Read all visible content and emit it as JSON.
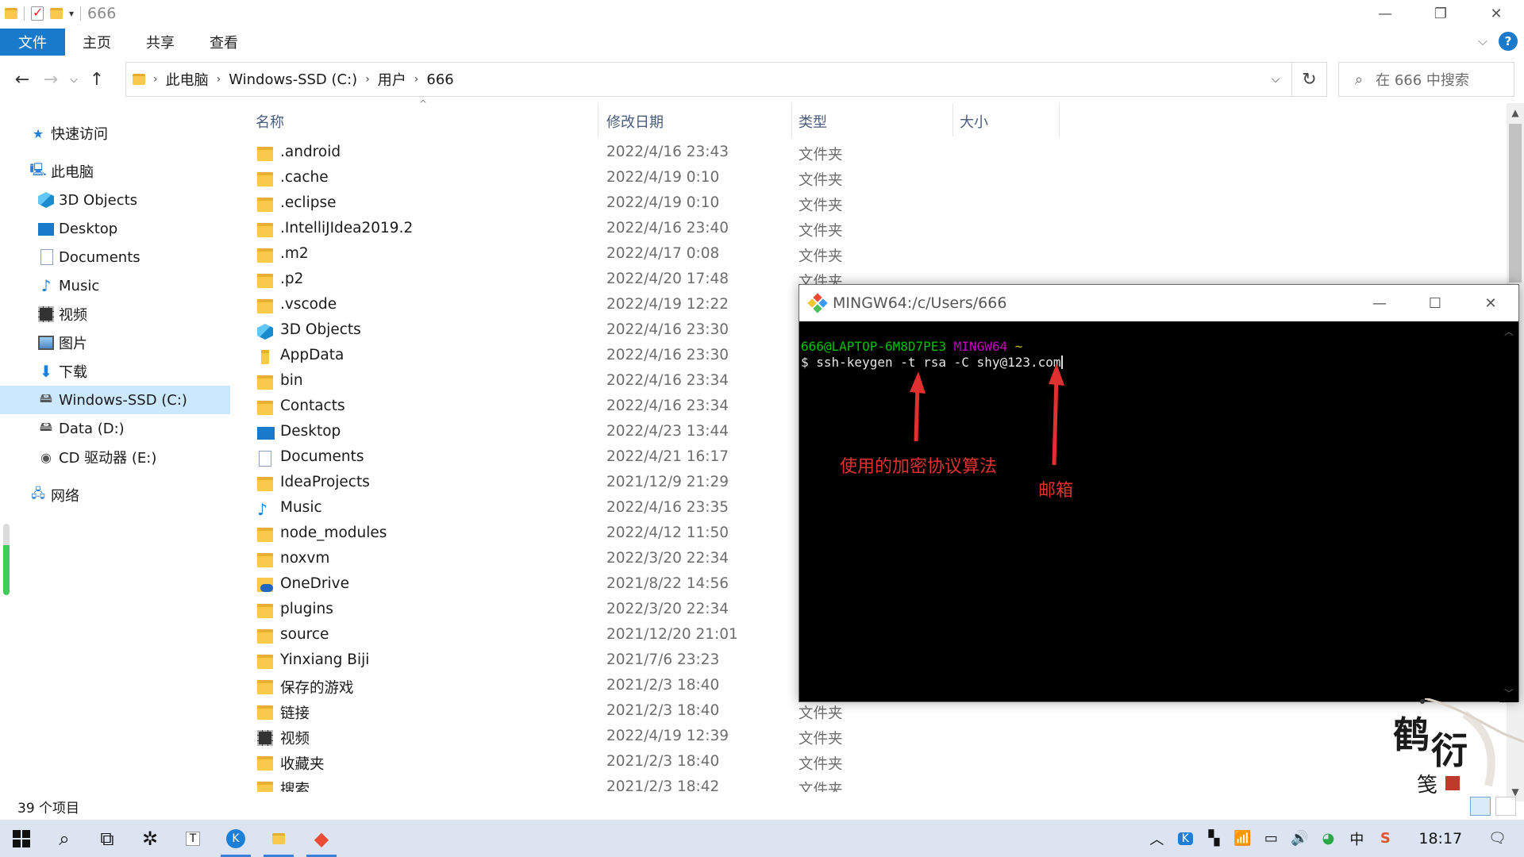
{
  "explorer": {
    "title": "666",
    "ribbon_tabs": [
      "文件",
      "主页",
      "共享",
      "查看"
    ],
    "breadcrumb": [
      "此电脑",
      "Windows-SSD (C:)",
      "用户",
      "666"
    ],
    "search_placeholder": "在 666 中搜索",
    "columns": [
      "名称",
      "修改日期",
      "类型",
      "大小"
    ],
    "sidebar": {
      "quick_access": "快速访问",
      "this_pc": "此电脑",
      "items": [
        "3D Objects",
        "Desktop",
        "Documents",
        "Music",
        "视频",
        "图片",
        "下载",
        "Windows-SSD (C:)",
        "Data (D:)",
        "CD 驱动器 (E:)"
      ],
      "network": "网络"
    },
    "files": [
      {
        "name": ".android",
        "date": "2022/4/16 23:43",
        "type": "文件夹",
        "icon": "folder"
      },
      {
        "name": ".cache",
        "date": "2022/4/19 0:10",
        "type": "文件夹",
        "icon": "folder"
      },
      {
        "name": ".eclipse",
        "date": "2022/4/19 0:10",
        "type": "文件夹",
        "icon": "folder"
      },
      {
        "name": ".IntelliJIdea2019.2",
        "date": "2022/4/16 23:40",
        "type": "文件夹",
        "icon": "folder"
      },
      {
        "name": ".m2",
        "date": "2022/4/17 0:08",
        "type": "文件夹",
        "icon": "folder"
      },
      {
        "name": ".p2",
        "date": "2022/4/20 17:48",
        "type": "文件夹",
        "icon": "folder"
      },
      {
        "name": ".vscode",
        "date": "2022/4/19 12:22",
        "type": "",
        "icon": "folder"
      },
      {
        "name": "3D Objects",
        "date": "2022/4/16 23:30",
        "type": "",
        "icon": "3d"
      },
      {
        "name": "AppData",
        "date": "2022/4/16 23:30",
        "type": "",
        "icon": "folder-narrow"
      },
      {
        "name": "bin",
        "date": "2022/4/16 23:34",
        "type": "",
        "icon": "folder"
      },
      {
        "name": "Contacts",
        "date": "2022/4/16 23:34",
        "type": "",
        "icon": "folder"
      },
      {
        "name": "Desktop",
        "date": "2022/4/23 13:44",
        "type": "",
        "icon": "desktop"
      },
      {
        "name": "Documents",
        "date": "2022/4/21 16:17",
        "type": "",
        "icon": "doc"
      },
      {
        "name": "IdeaProjects",
        "date": "2021/12/9 21:29",
        "type": "",
        "icon": "folder"
      },
      {
        "name": "Music",
        "date": "2022/4/16 23:35",
        "type": "",
        "icon": "music"
      },
      {
        "name": "node_modules",
        "date": "2022/4/12 11:50",
        "type": "",
        "icon": "folder"
      },
      {
        "name": "noxvm",
        "date": "2022/3/20 22:34",
        "type": "",
        "icon": "folder"
      },
      {
        "name": "OneDrive",
        "date": "2021/8/22 14:56",
        "type": "",
        "icon": "onedrive"
      },
      {
        "name": "plugins",
        "date": "2022/3/20 22:34",
        "type": "",
        "icon": "folder"
      },
      {
        "name": "source",
        "date": "2021/12/20 21:01",
        "type": "",
        "icon": "folder"
      },
      {
        "name": "Yinxiang Biji",
        "date": "2021/7/6 23:23",
        "type": "",
        "icon": "folder"
      },
      {
        "name": "保存的游戏",
        "date": "2021/2/3 18:40",
        "type": "",
        "icon": "folder"
      },
      {
        "name": "链接",
        "date": "2021/2/3 18:40",
        "type": "文件夹",
        "icon": "folder"
      },
      {
        "name": "视频",
        "date": "2022/4/19 12:39",
        "type": "文件夹",
        "icon": "video"
      },
      {
        "name": "收藏夹",
        "date": "2021/2/3 18:40",
        "type": "文件夹",
        "icon": "folder"
      },
      {
        "name": "搜索",
        "date": "2021/2/3 18:42",
        "type": "文件夹",
        "icon": "folder"
      }
    ],
    "status": "39 个项目"
  },
  "terminal": {
    "title": "MINGW64:/c/Users/666",
    "prompt_user": "666@LAPTOP-6M8D7PE3",
    "prompt_env": "MINGW64",
    "prompt_dir": "~",
    "command": "$ ssh-keygen -t rsa -C shy@123.com",
    "annotation_algo": "使用的加密协议算法",
    "annotation_email": "邮箱"
  },
  "taskbar": {
    "clock": "18:17",
    "ime": "中"
  },
  "colors": {
    "accent": "#1979ca",
    "prompt_green": "#00c000",
    "prompt_magenta": "#c000c0",
    "annotation_red": "#e03030"
  }
}
